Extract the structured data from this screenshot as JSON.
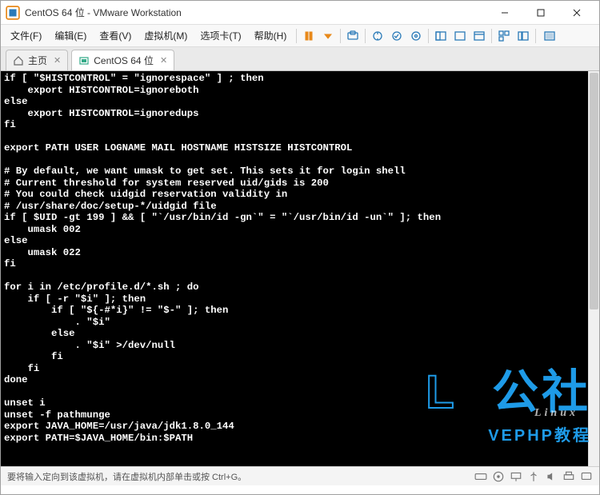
{
  "titlebar": {
    "title": "CentOS 64 位 - VMware Workstation"
  },
  "menubar": {
    "items": [
      "文件(F)",
      "编辑(E)",
      "查看(V)",
      "虚拟机(M)",
      "选项卡(T)",
      "帮助(H)"
    ]
  },
  "tabs": {
    "home": "主页",
    "vm": "CentOS 64 位"
  },
  "terminal": {
    "lines": [
      "if [ \"$HISTCONTROL\" = \"ignorespace\" ] ; then",
      "    export HISTCONTROL=ignoreboth",
      "else",
      "    export HISTCONTROL=ignoredups",
      "fi",
      "",
      "export PATH USER LOGNAME MAIL HOSTNAME HISTSIZE HISTCONTROL",
      "",
      "# By default, we want umask to get set. This sets it for login shell",
      "# Current threshold for system reserved uid/gids is 200",
      "# You could check uidgid reservation validity in",
      "# /usr/share/doc/setup-*/uidgid file",
      "if [ $UID -gt 199 ] && [ \"`/usr/bin/id -gn`\" = \"`/usr/bin/id -un`\" ]; then",
      "    umask 002",
      "else",
      "    umask 022",
      "fi",
      "",
      "for i in /etc/profile.d/*.sh ; do",
      "    if [ -r \"$i\" ]; then",
      "        if [ \"${-#*i}\" != \"$-\" ]; then",
      "            . \"$i\"",
      "        else",
      "            . \"$i\" >/dev/null",
      "        fi",
      "    fi",
      "done",
      "",
      "unset i",
      "unset -f pathmunge",
      "export JAVA_HOME=/usr/java/jdk1.8.0_144",
      "export PATH=$JAVA_HOME/bin:$PATH"
    ]
  },
  "statusbar": {
    "text": "要将输入定向到该虚拟机，请在虚拟机内部单击或按 Ctrl+G。"
  },
  "watermark": {
    "stroke": "L",
    "big": "公社",
    "sub": "VEPHP教程",
    "sub2": "Linux"
  }
}
